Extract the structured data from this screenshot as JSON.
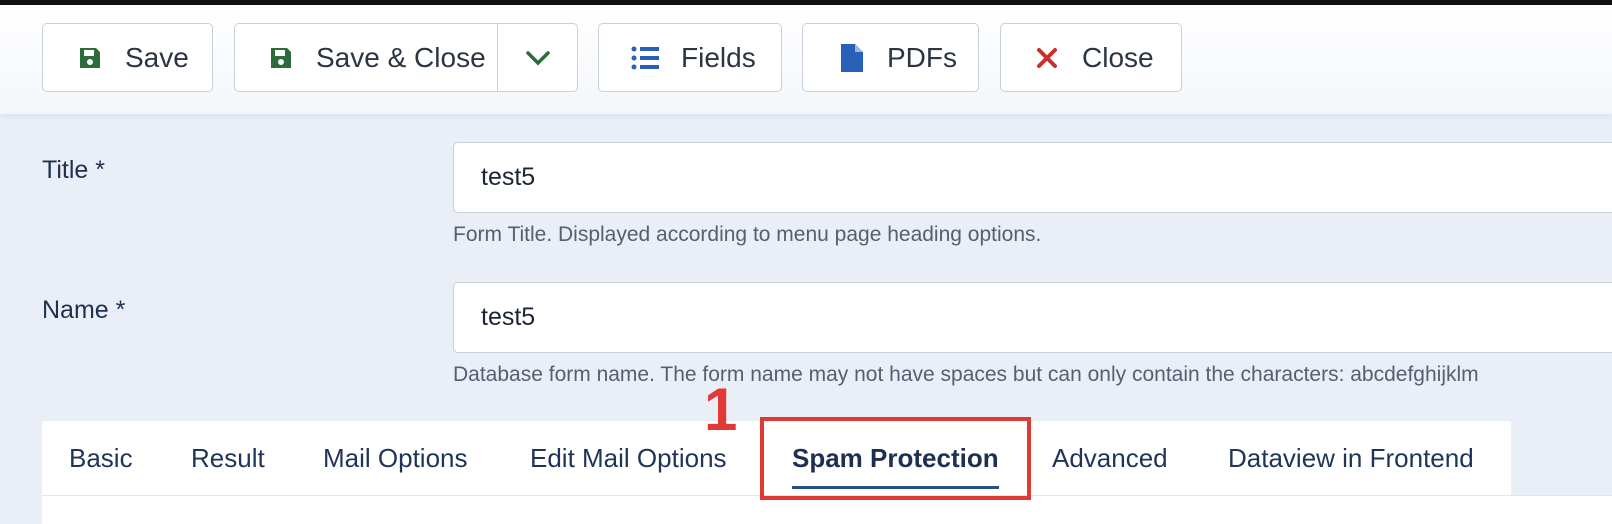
{
  "toolbar": {
    "save_label": "Save",
    "save_close_label": "Save & Close",
    "fields_label": "Fields",
    "pdfs_label": "PDFs",
    "close_label": "Close"
  },
  "form": {
    "title_label": "Title *",
    "title_value": "test5",
    "title_help": "Form Title. Displayed according to menu page heading options.",
    "name_label": "Name *",
    "name_value": "test5",
    "name_help": "Database form name. The form name may not have spaces but can only contain the characters: abcdefghijklm"
  },
  "tabs": [
    {
      "label": "Basic"
    },
    {
      "label": "Result"
    },
    {
      "label": "Mail Options"
    },
    {
      "label": "Edit Mail Options"
    },
    {
      "label": "Spam Protection",
      "active": true
    },
    {
      "label": "Advanced"
    },
    {
      "label": "Dataview in Frontend"
    }
  ],
  "annotation": {
    "marker": "1",
    "color": "#e03a36"
  },
  "colors": {
    "save_icon": "#2e6b3c",
    "fields_icon": "#2a5fb8",
    "pdf_icon": "#2a5fb8",
    "close_icon": "#c9302c",
    "page_bg": "#eaeff7"
  },
  "icons": {
    "save": "floppy-disk-icon",
    "dropdown": "chevron-down-icon",
    "fields": "list-icon",
    "pdfs": "file-icon",
    "close": "close-icon"
  }
}
